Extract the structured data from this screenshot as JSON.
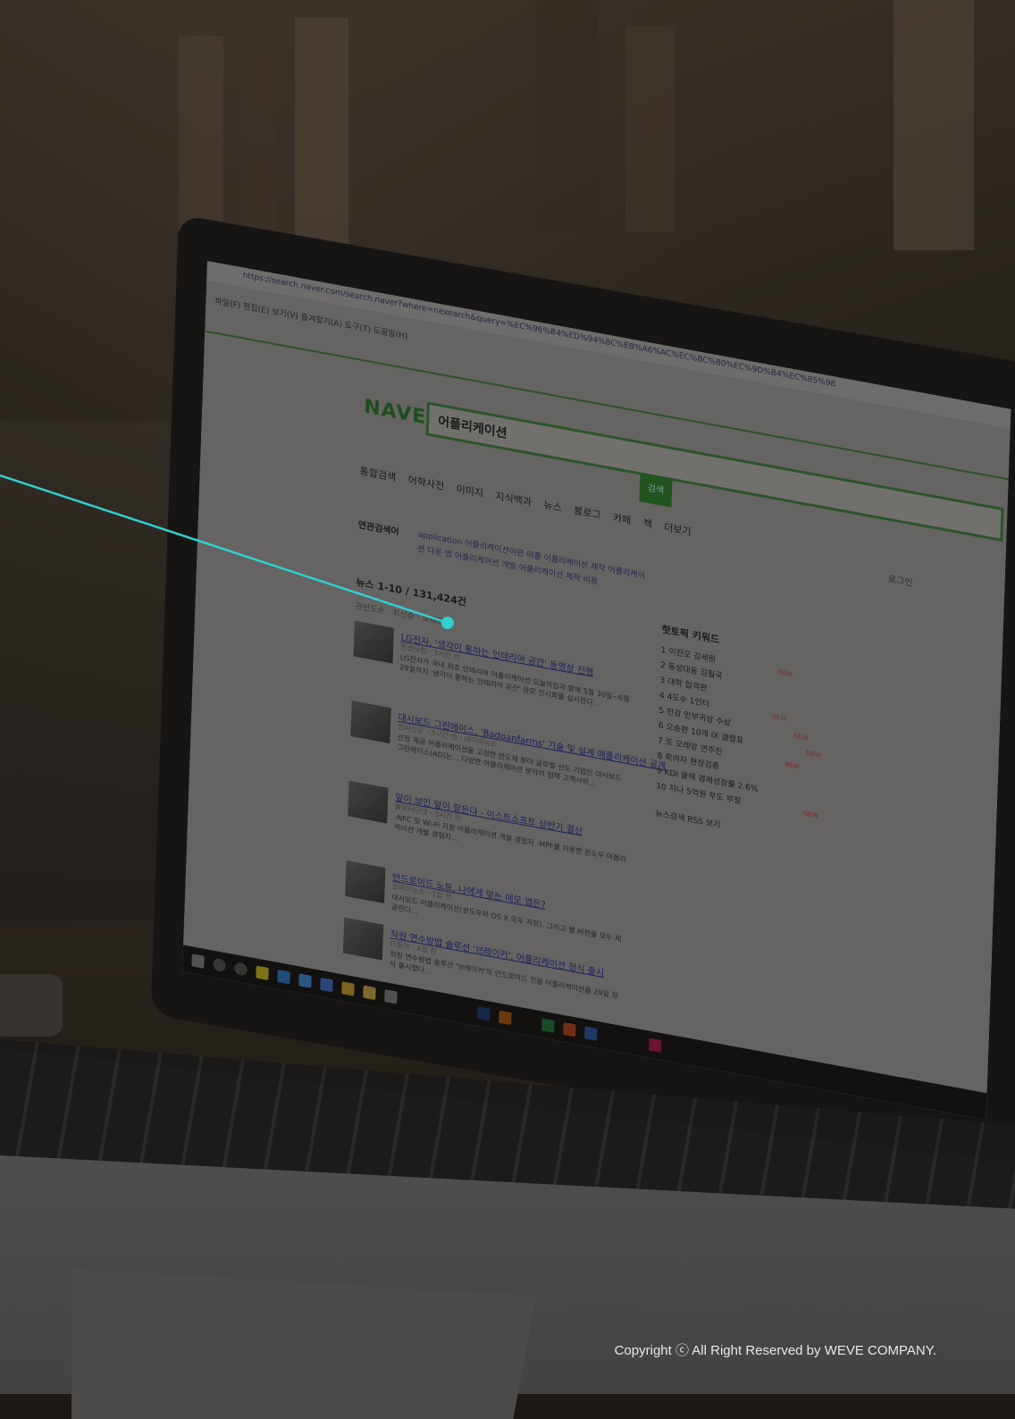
{
  "browser": {
    "url": "https://search.naver.com/search.naver?where=nexearch&query=%EC%96%B4%ED%94%8C%EB%A6%AC%EC%BC%80%EC%9D%B4%EC%85%98",
    "menu": "파일(F)  편집(E)  보기(V)  즐겨찾기(A)  도구(T)  도움말(H)"
  },
  "naver": {
    "logo": "NAVER",
    "query": "어플리케이션",
    "search_button": "검색",
    "tabs": "통합검색 어학사전 이미지 지식백과 뉴스 블로그 카페 책 더보기",
    "login": "로그인",
    "related_label": "연관검색어",
    "related_links": "application 어플리케이션이란 어플 어플리케이션 제작 어플리케이션 다운 앱 어플리케이션 개발 어플리케이션 제작 비용",
    "news_header": "뉴스  1-10 / 131,424건",
    "news_options": "관련도순 · 최신순 · 오래된순"
  },
  "news_items": [
    {
      "title": "LG전자, '생각이 통하는 인테리어 공간' 동영상 진행",
      "meta": "한경닷컴 · 3시간 전",
      "body": "LG전자가 국내 최초 인테리어 어플리케이션 오늘의집과 함께 5월 30일~6월 29일까지 '생각이 통하는 인테리어 공간' 응모 전시회를 실시한다..."
    },
    {
      "title": "대시보드 그린에이스, 'Badpanfarms' 기술 및 설계 애플리케이션 공개",
      "meta": "전자신문 · 3시간 전 · 네이버뉴스",
      "body": "선정 제공 어플리케이션을 고정한 반도체 분야 글로벌 선도 기업인 대시보드 그린에이스(AD)는... 다양한 어플리케이션 분야의 협력 고객사와..."
    },
    {
      "title": "앞이 보인 앞이 잘든다 - 이스트소프트 상반기 결산",
      "meta": "블로터닷넷 · 3시간 전",
      "body": "-NFC 및 Wi-Fi 지원 어플리케이션 개발 경험자 -MPF를 이용한 윈도우 어플리케이션 개발 경험자..."
    },
    {
      "title": "안드로이드 노트, 나에게 맞는 메모 앱은?",
      "meta": "오마이뉴스 · 1일 전",
      "body": "대시보드 어플리케이션(윈도우와 OS X 모두 지원). 그리고 웹 버전을 모두 제공한다..."
    },
    {
      "title": "직원 연수방법 솔루션 '브레이커', 어플리케이션 정식 출시",
      "meta": "IT동아 · 4일 전",
      "body": "직원 연수방법 솔루션 '브레이커'의 안드로이드 전용 어플리케이션을 29일 정식 출시했다..."
    }
  ],
  "side_panel": {
    "title": "핫토픽 키워드",
    "keywords": [
      {
        "rank": "1",
        "text": "이천오 김세원",
        "new": "NEW"
      },
      {
        "rank": "2",
        "text": "동성대동 김필국",
        "new": ""
      },
      {
        "rank": "3",
        "text": "대학 합격편",
        "new": ""
      },
      {
        "rank": "4",
        "text": "4도수 1인터",
        "new": "NEW"
      },
      {
        "rank": "5",
        "text": "한강 만부귀상 수상",
        "new": "NEW"
      },
      {
        "rank": "6",
        "text": "오송편 10개 IX 결렬표",
        "new": "NEW"
      },
      {
        "rank": "7",
        "text": "또 오레앙 연주진",
        "new": "NEW"
      },
      {
        "rank": "8",
        "text": "회의자 현장검증",
        "new": ""
      },
      {
        "rank": "9",
        "text": "KDI 올해 경제성장률 2.6%",
        "new": ""
      },
      {
        "rank": "10",
        "text": "지나 5억원 부도 부정",
        "new": "NEW"
      }
    ],
    "footer": "뉴스검색 RSS 보기"
  },
  "footer": {
    "copyright": "Copyright ⓒ All Right Reserved by WEVE COMPANY."
  },
  "colors": {
    "callout": "#2fd0d0",
    "naver_green": "#2b7d2b"
  }
}
